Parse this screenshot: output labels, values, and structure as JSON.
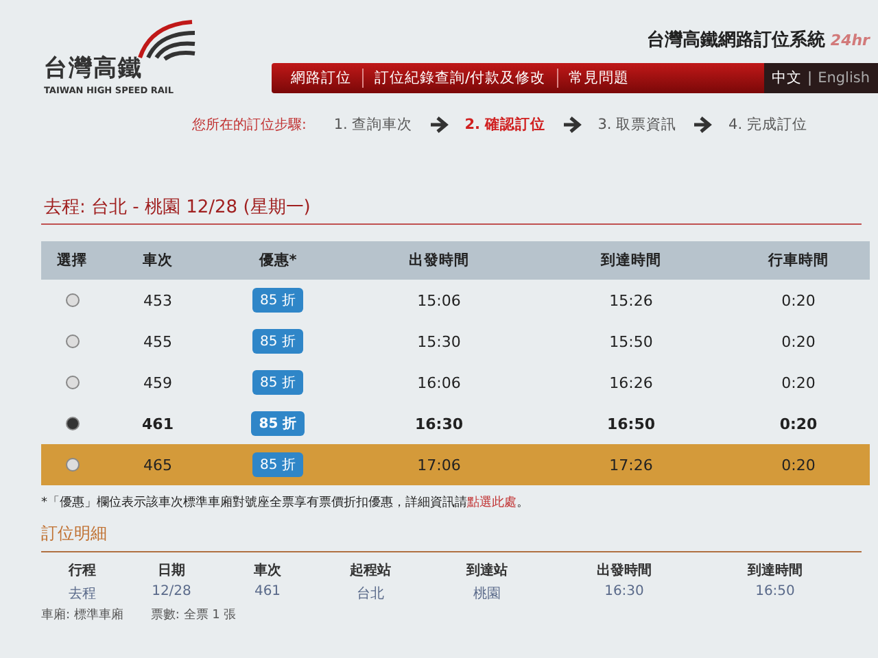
{
  "header": {
    "logo_text": "台灣高鐵",
    "logo_subtext": "TAIWAN HIGH SPEED RAIL",
    "system_title": "台灣高鐵網路訂位系統",
    "badge": "24hr",
    "nav": [
      {
        "label": "網路訂位"
      },
      {
        "label": "訂位紀錄查詢/付款及修改"
      },
      {
        "label": "常見問題"
      }
    ],
    "language_separator": "|",
    "languages": [
      {
        "label": "中文",
        "selected": true
      },
      {
        "label": "English",
        "selected": false
      }
    ]
  },
  "steps": {
    "label": "您所在的訂位步驟:",
    "items": [
      {
        "label": "1. 查詢車次",
        "selected": false
      },
      {
        "label": "2. 確認訂位",
        "selected": true
      },
      {
        "label": "3. 取票資訊",
        "selected": false
      },
      {
        "label": "4. 完成訂位",
        "selected": false
      }
    ]
  },
  "route_title": "去程: 台北 - 桃園 12/28 (星期一)",
  "table": {
    "columns": [
      "選擇",
      "車次",
      "優惠*",
      "出發時間",
      "到達時間",
      "行車時間"
    ],
    "rows": [
      {
        "train": "453",
        "discount": "85 折",
        "depart": "15:06",
        "arrive": "15:26",
        "duration": "0:20",
        "selected": false,
        "highlighted": false
      },
      {
        "train": "455",
        "discount": "85 折",
        "depart": "15:30",
        "arrive": "15:50",
        "duration": "0:20",
        "selected": false,
        "highlighted": false
      },
      {
        "train": "459",
        "discount": "85 折",
        "depart": "16:06",
        "arrive": "16:26",
        "duration": "0:20",
        "selected": false,
        "highlighted": false
      },
      {
        "train": "461",
        "discount": "85 折",
        "depart": "16:30",
        "arrive": "16:50",
        "duration": "0:20",
        "selected": true,
        "highlighted": false
      },
      {
        "train": "465",
        "discount": "85 折",
        "depart": "17:06",
        "arrive": "17:26",
        "duration": "0:20",
        "selected": false,
        "highlighted": true
      }
    ]
  },
  "footnote": {
    "text": "*「優惠」欄位表示該車次標準車廂對號座全票享有票價折扣優惠，詳細資訊請",
    "link": "點選此處",
    "end": "。"
  },
  "detail": {
    "title": "訂位明細",
    "columns": [
      "行程",
      "日期",
      "車次",
      "起程站",
      "到達站",
      "出發時間",
      "到達時間"
    ],
    "row": [
      "去程",
      "12/28",
      "461",
      "台北",
      "桃園",
      "16:30",
      "16:50"
    ],
    "extras": [
      "車廂: 標準車廂",
      "票數: 全票 1 張"
    ]
  }
}
